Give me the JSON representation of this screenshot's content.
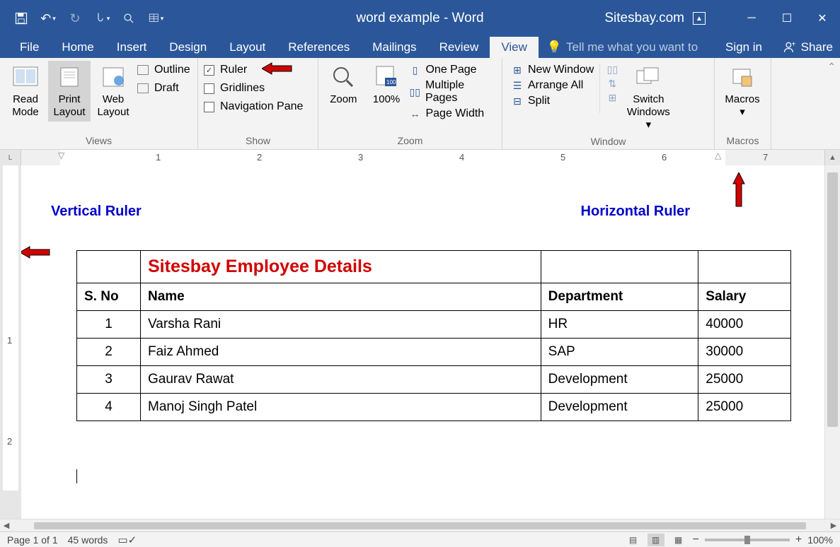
{
  "titlebar": {
    "title": "word example - Word",
    "site": "Sitesbay.com"
  },
  "menu": {
    "file": "File",
    "home": "Home",
    "insert": "Insert",
    "design": "Design",
    "layout": "Layout",
    "references": "References",
    "mailings": "Mailings",
    "review": "Review",
    "view": "View",
    "tell": "Tell me what you want to",
    "signin": "Sign in",
    "share": "Share"
  },
  "ribbon": {
    "views": {
      "read": "Read Mode",
      "print": "Print Layout",
      "web": "Web Layout",
      "outline": "Outline",
      "draft": "Draft",
      "label": "Views"
    },
    "show": {
      "ruler": "Ruler",
      "gridlines": "Gridlines",
      "navpane": "Navigation Pane",
      "label": "Show"
    },
    "zoom": {
      "zoom": "Zoom",
      "hundred": "100%",
      "onepage": "One Page",
      "multipages": "Multiple Pages",
      "pagewidth": "Page Width",
      "label": "Zoom"
    },
    "window": {
      "newwin": "New Window",
      "arrange": "Arrange All",
      "split": "Split",
      "switch": "Switch Windows",
      "label": "Window"
    },
    "macros": {
      "macros": "Macros",
      "label": "Macros"
    }
  },
  "annotations": {
    "vertical": "Vertical Ruler",
    "horizontal": "Horizontal Ruler"
  },
  "hruler": {
    "marks": [
      "1",
      "2",
      "3",
      "4",
      "5",
      "6",
      "7"
    ]
  },
  "vruler": {
    "marks": [
      "1",
      "2"
    ]
  },
  "table": {
    "title": "Sitesbay Employee Details",
    "headers": {
      "sno": "S. No",
      "name": "Name",
      "dept": "Department",
      "salary": "Salary"
    },
    "rows": [
      {
        "sno": "1",
        "name": "Varsha Rani",
        "dept": "HR",
        "salary": "40000"
      },
      {
        "sno": "2",
        "name": "Faiz Ahmed",
        "dept": "SAP",
        "salary": "30000"
      },
      {
        "sno": "3",
        "name": "Gaurav Rawat",
        "dept": "Development",
        "salary": "25000"
      },
      {
        "sno": "4",
        "name": "Manoj Singh Patel",
        "dept": "Development",
        "salary": "25000"
      }
    ]
  },
  "status": {
    "page": "Page 1 of 1",
    "words": "45 words",
    "zoom": "100%"
  }
}
